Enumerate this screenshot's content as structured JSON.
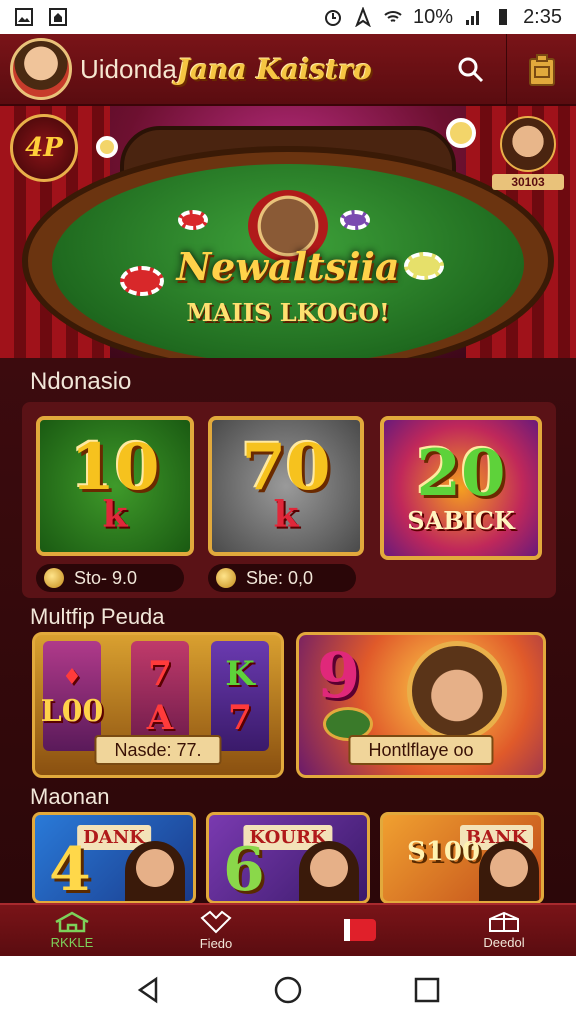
{
  "status_bar": {
    "battery": "10%",
    "time": "2:35"
  },
  "header": {
    "brand_prefix": "Uidonda",
    "brand_script": "Jana Kaistro"
  },
  "hero": {
    "badge_left": "4P",
    "title": "Newaltsiia",
    "subtitle": "MAIIS LKOGO!",
    "badge_right_label": "30103"
  },
  "sections": {
    "featured_title": "Ndonasio",
    "multiplayer_title": "Multfip Peuda",
    "more_title": "Maonan"
  },
  "featured_tiles": [
    {
      "number": "10",
      "suffix": "k",
      "caption": "Sto- 9.0",
      "number_color": "#f6c21e"
    },
    {
      "number": "70",
      "suffix": "k",
      "caption": "Sbe: 0,0",
      "number_color": "#f6c21e"
    },
    {
      "number": "20",
      "suffix": "SABICK",
      "caption": "",
      "number_color": "#5ed23a"
    }
  ],
  "games": [
    {
      "label": "Nasde: 77.",
      "reels": [
        [
          "♦",
          "L00",
          "♦"
        ],
        [
          "7",
          "A",
          "7"
        ],
        [
          "K",
          "7",
          "♦"
        ]
      ]
    },
    {
      "label": "Hontlflaye oo",
      "big": "9"
    }
  ],
  "thumbs": [
    {
      "banner": "DANK",
      "big": "4"
    },
    {
      "banner": "KOURK",
      "big": "6"
    },
    {
      "banner": "BANK",
      "big": "S100"
    }
  ],
  "bottom_nav": [
    {
      "label": "RKKLE",
      "icon": "home-icon",
      "active": true
    },
    {
      "label": "Fiedo",
      "icon": "heart-icon",
      "active": false
    },
    {
      "label": "",
      "icon": "ticket-icon",
      "active": false
    },
    {
      "label": "Deedol",
      "icon": "box-icon",
      "active": false
    }
  ]
}
